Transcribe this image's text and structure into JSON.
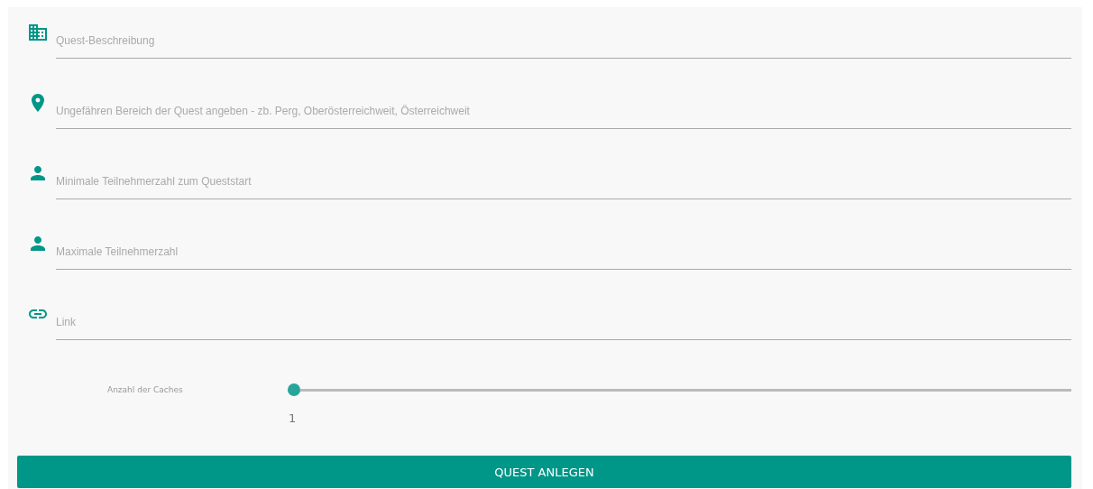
{
  "fields": [
    {
      "placeholder": "Quest-Beschreibung"
    },
    {
      "placeholder": "Ungefähren Bereich der Quest angeben - zb. Perg, Oberösterreichweit, Österreichweit"
    },
    {
      "placeholder": "Minimale Teilnehmerzahl zum Queststart"
    },
    {
      "placeholder": "Maximale Teilnehmerzahl"
    },
    {
      "placeholder": "Link"
    }
  ],
  "slider": {
    "label": "Anzahl der Caches",
    "level": 0,
    "reading": "1"
  },
  "submit_button": "QUEST ANLEGEN"
}
